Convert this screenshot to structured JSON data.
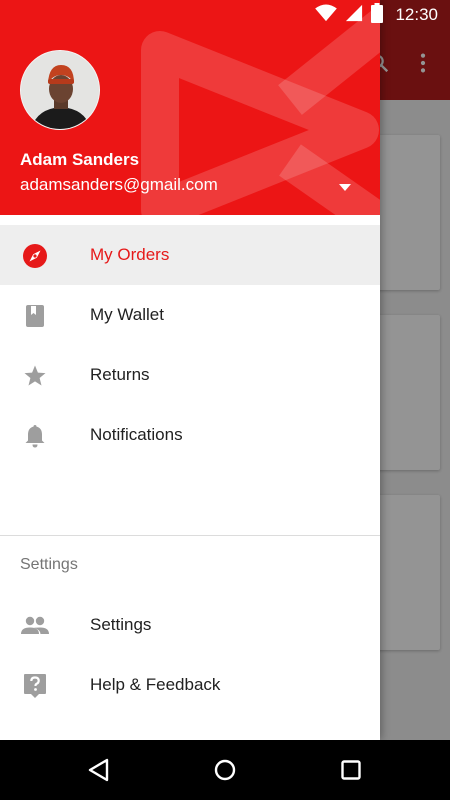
{
  "status_bar": {
    "time": "12:30",
    "icons": [
      "wifi-icon",
      "signal-icon",
      "battery-icon"
    ]
  },
  "background_app": {
    "toolbar_icons": [
      "search-icon",
      "more-vert-icon"
    ]
  },
  "drawer": {
    "header": {
      "name": "Adam Sanders",
      "email": "adamsanders@gmail.com",
      "accent_color": "#ec1515"
    },
    "items": [
      {
        "label": "My Orders",
        "icon": "compass-icon",
        "active": true
      },
      {
        "label": "My Wallet",
        "icon": "book-icon",
        "active": false
      },
      {
        "label": "Returns",
        "icon": "star-icon",
        "active": false
      },
      {
        "label": "Notifications",
        "icon": "bell-icon",
        "active": false
      }
    ],
    "section_title": "Settings",
    "settings_items": [
      {
        "label": "Settings",
        "icon": "people-icon"
      },
      {
        "label": "Help & Feedback",
        "icon": "help-icon"
      }
    ]
  },
  "system_nav": [
    "back-icon",
    "home-icon",
    "recents-icon"
  ],
  "colors": {
    "accent": "#e61919",
    "icon_gray": "#9e9e9e"
  }
}
